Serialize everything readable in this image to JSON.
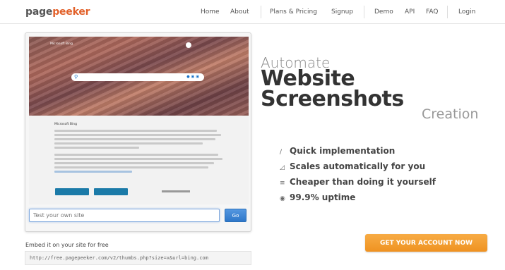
{
  "header": {
    "logo_part1": "page",
    "logo_part2": "peeker",
    "nav": [
      "Home",
      "About",
      "Plans & Pricing",
      "Signup",
      "Demo",
      "API",
      "FAQ",
      "Login"
    ]
  },
  "demo": {
    "url_placeholder": "Test your own site",
    "go_label": "Go",
    "preview_brand": "Microsoft Bing",
    "preview_consent_brand": "Microsoft Bing"
  },
  "embed": {
    "label": "Embed it on your site for free",
    "code": "http://free.pagepeeker.com/v2/thumbs.php?size=x&url=bing.com"
  },
  "hero": {
    "line1": "Automate",
    "line2": "Website",
    "line3": "Screenshots",
    "line4": "Creation"
  },
  "features": [
    {
      "icon": "pencil-icon",
      "glyph": "∕",
      "label": "Quick implementation"
    },
    {
      "icon": "chart-icon",
      "glyph": "◿",
      "label": "Scales automatically for you"
    },
    {
      "icon": "list-icon",
      "glyph": "≡",
      "label": "Cheaper than doing it yourself"
    },
    {
      "icon": "uptime-icon",
      "glyph": "◉",
      "label": "99.9% uptime"
    }
  ],
  "cta": {
    "label": "GET YOUR ACCOUNT NOW"
  },
  "colors": {
    "brand_orange": "#e2612a",
    "cta_orange": "#f39a2b",
    "go_blue": "#2f77c9"
  }
}
